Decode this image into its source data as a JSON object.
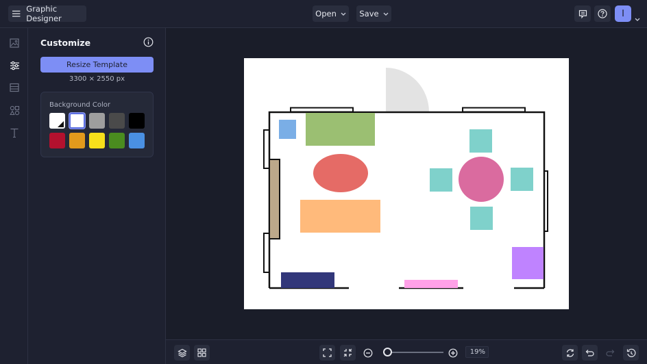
{
  "header": {
    "app_title": "Graphic Designer",
    "open_label": "Open",
    "save_label": "Save",
    "avatar_initial": "I"
  },
  "rail": {
    "items": [
      {
        "name": "images",
        "icon": "image-icon",
        "active": false
      },
      {
        "name": "customize",
        "icon": "sliders-icon",
        "active": true
      },
      {
        "name": "layout",
        "icon": "layout-icon",
        "active": false
      },
      {
        "name": "elements",
        "icon": "shapes-icon",
        "active": false
      },
      {
        "name": "text",
        "icon": "text-icon",
        "active": false
      }
    ]
  },
  "panel": {
    "title": "Customize",
    "resize_label": "Resize Template",
    "dimensions": "3300 × 2550 px",
    "background_color_label": "Background Color",
    "swatches": [
      {
        "name": "transparent",
        "color": "#ffffff",
        "selected": false
      },
      {
        "name": "white",
        "color": "#ffffff",
        "selected": true
      },
      {
        "name": "gray",
        "color": "#9e9e9e",
        "selected": false
      },
      {
        "name": "dark-gray",
        "color": "#4a4a4a",
        "selected": false
      },
      {
        "name": "black",
        "color": "#000000",
        "selected": false
      },
      {
        "name": "red",
        "color": "#b3112e",
        "selected": false
      },
      {
        "name": "orange",
        "color": "#e29a1c",
        "selected": false
      },
      {
        "name": "yellow",
        "color": "#f7e01b",
        "selected": false
      },
      {
        "name": "green",
        "color": "#4a8c1f",
        "selected": false
      },
      {
        "name": "blue",
        "color": "#4a90e2",
        "selected": false
      }
    ]
  },
  "canvas": {
    "background": "#ffffff",
    "shape_colors": {
      "rug_blue": "#7aaee6",
      "green_rect": "#9bbf72",
      "red_oval": "#e56b66",
      "orange_rect": "#ffba7b",
      "navy_rect": "#32377a",
      "pink_strip": "#ffa1e8",
      "purple_square": "#bf83ff",
      "teal_chair": "#7fd1cb",
      "pink_table": "#da6b9f",
      "tan_strip": "#bca88a",
      "gray_arc": "#e3e3e3",
      "wall": "#111111"
    }
  },
  "bottombar": {
    "zoom_value": "19%",
    "zoom_fraction": 0.05
  },
  "accent_color": "#7d8ef5"
}
